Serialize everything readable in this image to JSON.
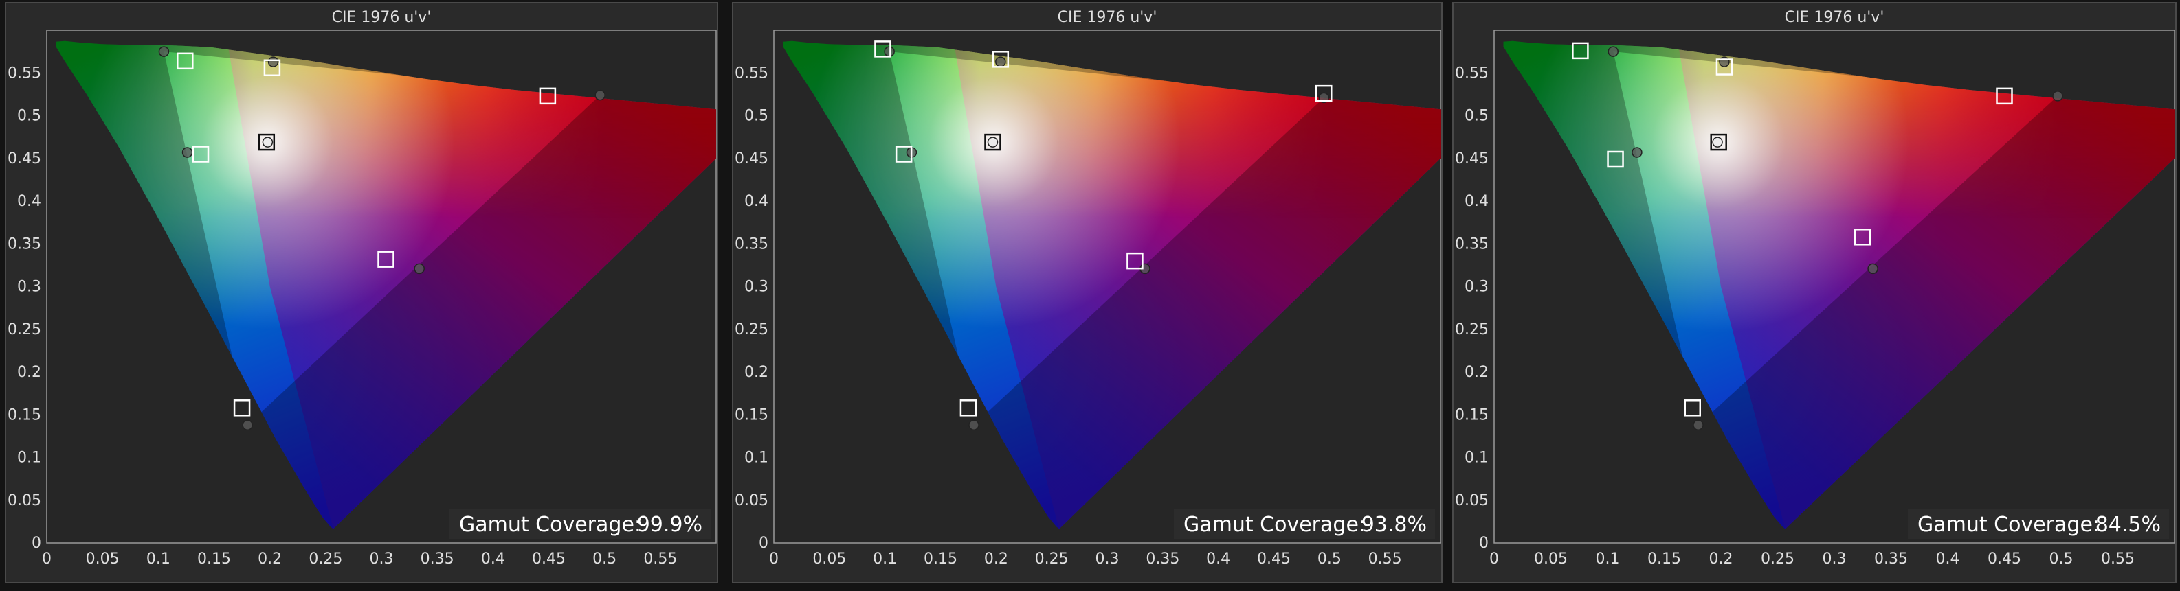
{
  "chart_data": [
    {
      "type": "scatter",
      "title": "CIE 1976 u'v'",
      "xlim": [
        0,
        0.6
      ],
      "ylim": [
        0,
        0.6
      ],
      "x_ticks": [
        "0",
        "0.05",
        "0.1",
        "0.15",
        "0.2",
        "0.25",
        "0.3",
        "0.35",
        "0.4",
        "0.45",
        "0.5",
        "0.55"
      ],
      "y_ticks": [
        "0",
        "0.05",
        "0.1",
        "0.15",
        "0.2",
        "0.25",
        "0.3",
        "0.35",
        "0.4",
        "0.45",
        "0.5",
        "0.55"
      ],
      "coverage_label": "Gamut Coverage:",
      "coverage_value": "99.9%",
      "targets": [
        {
          "u": 0.124,
          "v": 0.564
        },
        {
          "u": 0.202,
          "v": 0.556
        },
        {
          "u": 0.449,
          "v": 0.523
        },
        {
          "u": 0.138,
          "v": 0.455
        },
        {
          "u": 0.197,
          "v": 0.469
        },
        {
          "u": 0.304,
          "v": 0.332
        },
        {
          "u": 0.175,
          "v": 0.158
        }
      ],
      "measured": [
        {
          "u": 0.105,
          "v": 0.575
        },
        {
          "u": 0.203,
          "v": 0.563
        },
        {
          "u": 0.496,
          "v": 0.524
        },
        {
          "u": 0.126,
          "v": 0.457
        },
        {
          "u": 0.198,
          "v": 0.469
        },
        {
          "u": 0.334,
          "v": 0.321
        },
        {
          "u": 0.18,
          "v": 0.138
        }
      ]
    },
    {
      "type": "scatter",
      "title": "CIE 1976 u'v'",
      "xlim": [
        0,
        0.6
      ],
      "ylim": [
        0,
        0.6
      ],
      "x_ticks": [
        "0",
        "0.05",
        "0.1",
        "0.15",
        "0.2",
        "0.25",
        "0.3",
        "0.35",
        "0.4",
        "0.45",
        "0.5",
        "0.55"
      ],
      "y_ticks": [
        "0",
        "0.05",
        "0.1",
        "0.15",
        "0.2",
        "0.25",
        "0.3",
        "0.35",
        "0.4",
        "0.45",
        "0.5",
        "0.55"
      ],
      "coverage_label": "Gamut Coverage:",
      "coverage_value": "93.8%",
      "targets": [
        {
          "u": 0.098,
          "v": 0.578
        },
        {
          "u": 0.204,
          "v": 0.566
        },
        {
          "u": 0.495,
          "v": 0.526
        },
        {
          "u": 0.117,
          "v": 0.455
        },
        {
          "u": 0.197,
          "v": 0.469
        },
        {
          "u": 0.325,
          "v": 0.33
        },
        {
          "u": 0.175,
          "v": 0.158
        }
      ],
      "measured": [
        {
          "u": 0.104,
          "v": 0.575
        },
        {
          "u": 0.204,
          "v": 0.563
        },
        {
          "u": 0.495,
          "v": 0.521
        },
        {
          "u": 0.124,
          "v": 0.457
        },
        {
          "u": 0.197,
          "v": 0.469
        },
        {
          "u": 0.334,
          "v": 0.321
        },
        {
          "u": 0.18,
          "v": 0.138
        }
      ]
    },
    {
      "type": "scatter",
      "title": "CIE 1976 u'v'",
      "xlim": [
        0,
        0.6
      ],
      "ylim": [
        0,
        0.6
      ],
      "x_ticks": [
        "0",
        "0.05",
        "0.1",
        "0.15",
        "0.2",
        "0.25",
        "0.3",
        "0.35",
        "0.4",
        "0.45",
        "0.5",
        "0.55"
      ],
      "y_ticks": [
        "0",
        "0.05",
        "0.1",
        "0.15",
        "0.2",
        "0.25",
        "0.3",
        "0.35",
        "0.4",
        "0.45",
        "0.5",
        "0.55"
      ],
      "coverage_label": "Gamut Coverage:",
      "coverage_value": "84.5%",
      "targets": [
        {
          "u": 0.076,
          "v": 0.576
        },
        {
          "u": 0.203,
          "v": 0.557
        },
        {
          "u": 0.45,
          "v": 0.523
        },
        {
          "u": 0.107,
          "v": 0.449
        },
        {
          "u": 0.198,
          "v": 0.469
        },
        {
          "u": 0.325,
          "v": 0.358
        },
        {
          "u": 0.175,
          "v": 0.158
        }
      ],
      "measured": [
        {
          "u": 0.105,
          "v": 0.575
        },
        {
          "u": 0.203,
          "v": 0.563
        },
        {
          "u": 0.497,
          "v": 0.523
        },
        {
          "u": 0.126,
          "v": 0.457
        },
        {
          "u": 0.197,
          "v": 0.469
        },
        {
          "u": 0.334,
          "v": 0.321
        },
        {
          "u": 0.18,
          "v": 0.138
        }
      ]
    }
  ]
}
